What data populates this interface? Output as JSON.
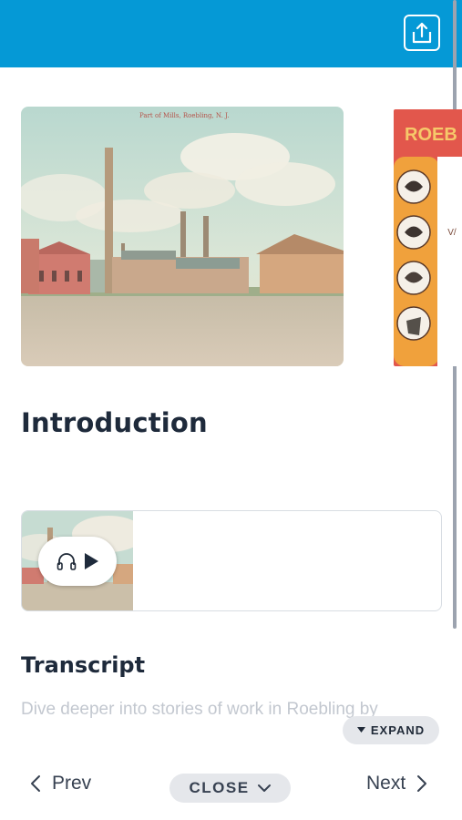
{
  "header": {
    "share_icon": "share-upload-icon",
    "accent_color": "#0599d6"
  },
  "carousel": {
    "slide1": {
      "caption": "Part of Mills, Roebling, N. J."
    },
    "slide2": {
      "heading": "ROEB"
    }
  },
  "page": {
    "title": "Introduction"
  },
  "audio": {
    "headphones_icon": "headphones-icon",
    "play_icon": "play-icon"
  },
  "transcript": {
    "heading": "Transcript",
    "text": "Dive deeper into stories of work in Roebling by",
    "expand_label": "EXPAND"
  },
  "nav": {
    "prev_label": "Prev",
    "close_label": "CLOSE",
    "next_label": "Next"
  }
}
